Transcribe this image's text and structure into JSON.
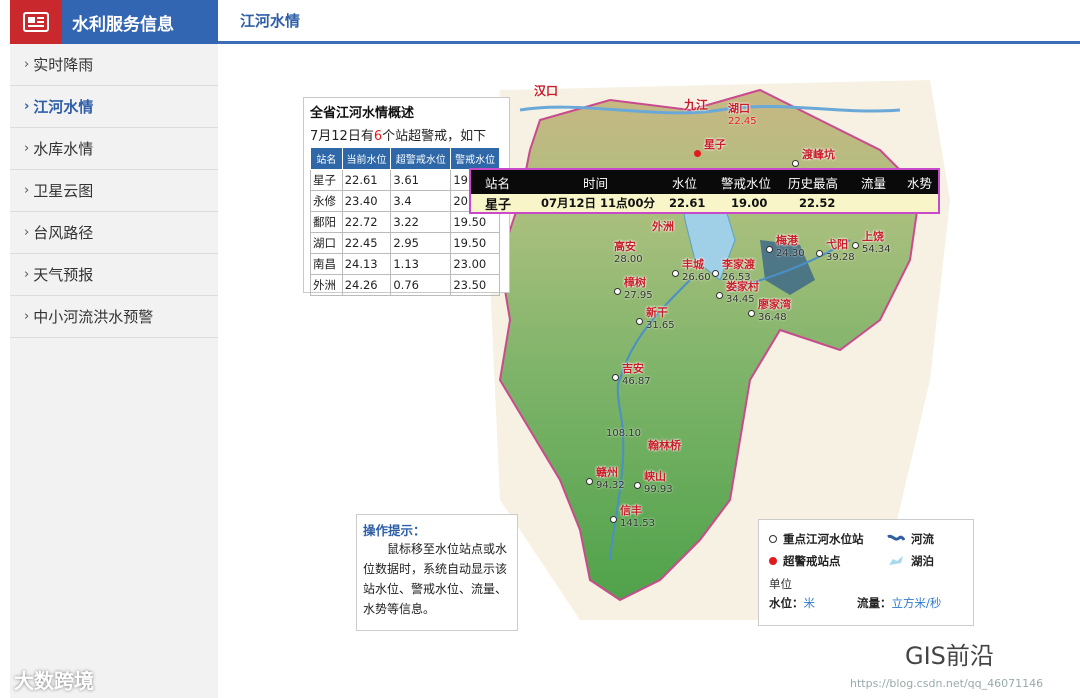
{
  "header": {
    "brand_title": "水利服务信息",
    "page_title": "江河水情"
  },
  "sidebar": {
    "items": [
      {
        "label": "实时降雨",
        "active": false
      },
      {
        "label": "江河水情",
        "active": true
      },
      {
        "label": "水库水情",
        "active": false
      },
      {
        "label": "卫星云图",
        "active": false
      },
      {
        "label": "台风路径",
        "active": false
      },
      {
        "label": "天气预报",
        "active": false
      },
      {
        "label": "中小河流洪水预警",
        "active": false
      }
    ]
  },
  "overview": {
    "title": "全省江河水情概述",
    "summary_prefix": "7月12日有",
    "summary_count": "6",
    "summary_suffix": "个站超警戒，如下",
    "columns": [
      "站名",
      "当前水位",
      "超警戒水位",
      "警戒水位"
    ],
    "rows": [
      [
        "星子",
        "22.61",
        "3.61",
        "19.00"
      ],
      [
        "永修",
        "23.40",
        "3.4",
        "20.00"
      ],
      [
        "鄱阳",
        "22.72",
        "3.22",
        "19.50"
      ],
      [
        "湖口",
        "22.45",
        "2.95",
        "19.50"
      ],
      [
        "南昌",
        "24.13",
        "1.13",
        "23.00"
      ],
      [
        "外洲",
        "24.26",
        "0.76",
        "23.50"
      ]
    ]
  },
  "tooltip": {
    "columns": [
      "站名",
      "时间",
      "水位",
      "警戒水位",
      "历史最高",
      "流量",
      "水势"
    ],
    "row": [
      "星子",
      "07月12日 11点00分",
      "22.61",
      "19.00",
      "22.52",
      "",
      ""
    ]
  },
  "map": {
    "labels": [
      {
        "text": "汉口"
      },
      {
        "text": "九江"
      }
    ],
    "stations": [
      {
        "name": "湖口",
        "value": "22.45",
        "alert": true
      },
      {
        "name": "星子",
        "value": "",
        "alert": true
      },
      {
        "name": "渡峰坑",
        "value": "",
        "alert": false
      },
      {
        "name": "外洲",
        "value": "",
        "alert": true
      },
      {
        "name": "梅港",
        "value": "24.30",
        "alert": false
      },
      {
        "name": "弋阳",
        "value": "39.28",
        "alert": false
      },
      {
        "name": "上饶",
        "value": "54.34",
        "alert": false
      },
      {
        "name": "高安",
        "value": "28.00",
        "alert": false
      },
      {
        "name": "丰城",
        "value": "26.60",
        "alert": false
      },
      {
        "name": "李家渡",
        "value": "26.53",
        "alert": false
      },
      {
        "name": "樟树",
        "value": "27.95",
        "alert": false
      },
      {
        "name": "娄家村",
        "value": "34.45",
        "alert": false
      },
      {
        "name": "新干",
        "value": "31.65",
        "alert": false
      },
      {
        "name": "廖家湾",
        "value": "36.48",
        "alert": false
      },
      {
        "name": "吉安",
        "value": "46.87",
        "alert": false
      },
      {
        "name": "翰林桥",
        "value": "108.10",
        "alert": false
      },
      {
        "name": "赣州",
        "value": "94.32",
        "alert": false
      },
      {
        "name": "峡山",
        "value": "99.93",
        "alert": false
      },
      {
        "name": "信丰",
        "value": "141.53",
        "alert": false
      }
    ]
  },
  "hint": {
    "title": "操作提示：",
    "text": "鼠标移至水位站点或水位数据时，系统自动显示该站水位、警戒水位、流量、水势等信息。"
  },
  "legend": {
    "station_label": "重点江河水位站",
    "river_label": "河流",
    "alert_label": "超警戒站点",
    "lake_label": "湖泊",
    "unit_title": "单位",
    "level_label": "水位：",
    "level_unit": "米",
    "flow_label": "流量：",
    "flow_unit": "立方米/秒"
  },
  "watermarks": {
    "left": "大数跨境",
    "right": "GIS前沿",
    "url": "https://blog.csdn.net/qq_46071146"
  },
  "colors": {
    "brand_blue": "#3366b2",
    "brand_red": "#c9282d",
    "alert_red": "#e31a1c",
    "tooltip_border": "#c84ac8"
  }
}
